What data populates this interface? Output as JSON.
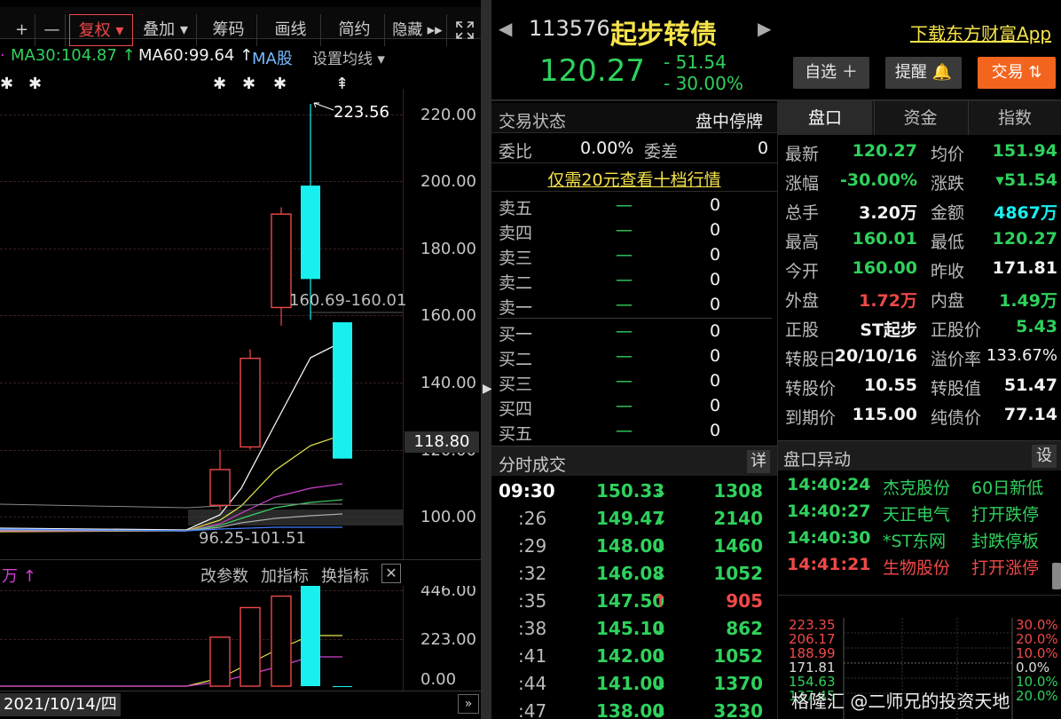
{
  "toolbar": {
    "items": [
      "+",
      "—",
      "复权 ▾",
      "叠加 ▾",
      "筹码",
      "画线",
      "简约",
      "隐藏 ▸▸"
    ],
    "expand_icon": "expand-icon"
  },
  "ma_bar": {
    "ma30": "MA30:104.87 ↑",
    "ma60": "MA60:99.64 ↑",
    "ma_type": "MA股",
    "set_ma": "设置均线 ▾"
  },
  "chart_data": {
    "type": "candlestick",
    "y_axis_ticks": [
      "220.00",
      "200.00",
      "180.00",
      "160.00",
      "140.00",
      "120.00",
      "100.00"
    ],
    "ylim": [
      91,
      228
    ],
    "annotations": {
      "high_label": "223.56",
      "range_label": "160.69-160.01",
      "low_label": "96.25-101.51",
      "current_price_tag": "118.80"
    },
    "candles": [
      {
        "open": 106.7,
        "close": 117.1,
        "high": 122.9,
        "low": 105.3,
        "color": "red"
      },
      {
        "open": 123.7,
        "close": 149.5,
        "high": 152.1,
        "low": 122.9,
        "color": "red"
      },
      {
        "open": 164.3,
        "close": 191.5,
        "high": 193.5,
        "low": 159.0,
        "color": "red"
      },
      {
        "open": 199.8,
        "close": 172.6,
        "high": 223.56,
        "low": 160.69,
        "color": "cyan"
      },
      {
        "open": 160.0,
        "close": 120.3,
        "high": 160.0,
        "low": 120.27,
        "color": "cyan"
      }
    ],
    "volume_ticks": [
      "446.00",
      "223.00",
      "0.00"
    ],
    "volume_ylim": [
      0,
      460
    ],
    "volumes": [
      {
        "value": 235,
        "color": "red"
      },
      {
        "value": 377,
        "color": "red"
      },
      {
        "value": 432,
        "color": "red"
      },
      {
        "value": 489,
        "color": "cyan"
      },
      {
        "value": 0,
        "color": "cyan"
      }
    ],
    "date_label": "2021/10/14/四"
  },
  "indicator_bar": {
    "left_text": "万 ↑",
    "change_params": "改参数",
    "add_indicator": "加指标",
    "switch_indicator": "换指标"
  },
  "header": {
    "code": "113576",
    "name": "起步转债",
    "download": "下载东方财富App",
    "price": "120.27",
    "change": "- 51.54",
    "change_pct": "- 30.00%",
    "watch_btn": "自选 ＋",
    "remind_btn": "提醒 🔔",
    "trade_btn": "交易 ⇅"
  },
  "status": {
    "label": "交易状态",
    "value": "盘中停牌",
    "weibi_label": "委比",
    "weibi_value": "0.00%",
    "weicha_label": "委差",
    "weicha_value": "0",
    "promo": "仅需20元查看十档行情"
  },
  "orderbook": {
    "sells": [
      {
        "label": "卖五",
        "price": "—",
        "vol": "0"
      },
      {
        "label": "卖四",
        "price": "—",
        "vol": "0"
      },
      {
        "label": "卖三",
        "price": "—",
        "vol": "0"
      },
      {
        "label": "卖二",
        "price": "—",
        "vol": "0"
      },
      {
        "label": "卖一",
        "price": "—",
        "vol": "0"
      }
    ],
    "buys": [
      {
        "label": "买一",
        "price": "—",
        "vol": "0"
      },
      {
        "label": "买二",
        "price": "—",
        "vol": "0"
      },
      {
        "label": "买三",
        "price": "—",
        "vol": "0"
      },
      {
        "label": "买四",
        "price": "—",
        "vol": "0"
      },
      {
        "label": "买五",
        "price": "—",
        "vol": "0"
      }
    ]
  },
  "ticks": {
    "title": "分时成交",
    "detail": "详",
    "rows": [
      {
        "time": "09:30",
        "price": "150.33",
        "dir": "down",
        "vol": "1308",
        "vcolor": "green"
      },
      {
        "time": ":26",
        "price": "149.47",
        "dir": "down",
        "vol": "2140",
        "vcolor": "green"
      },
      {
        "time": ":29",
        "price": "148.00",
        "dir": "down",
        "vol": "1460",
        "vcolor": "green"
      },
      {
        "time": ":32",
        "price": "146.08",
        "dir": "down",
        "vol": "1052",
        "vcolor": "green"
      },
      {
        "time": ":35",
        "price": "147.50",
        "dir": "up",
        "vol": "905",
        "vcolor": "red"
      },
      {
        "time": ":38",
        "price": "145.10",
        "dir": "down",
        "vol": "862",
        "vcolor": "green"
      },
      {
        "time": ":41",
        "price": "142.00",
        "dir": "down",
        "vol": "1052",
        "vcolor": "green"
      },
      {
        "time": ":44",
        "price": "141.00",
        "dir": "down",
        "vol": "1370",
        "vcolor": "green"
      },
      {
        "time": ":47",
        "price": "138.00",
        "dir": "down",
        "vol": "3230",
        "vcolor": "green"
      }
    ]
  },
  "tabs": [
    "盘口",
    "资金",
    "指数"
  ],
  "quote": [
    {
      "l1": "最新",
      "v1": "120.27",
      "c1": "green",
      "l2": "均价",
      "v2": "151.94",
      "c2": "green"
    },
    {
      "l1": "涨幅",
      "v1": "-30.00%",
      "c1": "green",
      "l2": "涨跌",
      "v2": "▾51.54",
      "c2": "green"
    },
    {
      "l1": "总手",
      "v1": "3.20万",
      "c1": "white",
      "l2": "金额",
      "v2": "4867万",
      "c2": "cyan"
    },
    {
      "l1": "最高",
      "v1": "160.01",
      "c1": "green",
      "l2": "最低",
      "v2": "120.27",
      "c2": "green"
    },
    {
      "l1": "今开",
      "v1": "160.00",
      "c1": "green",
      "l2": "昨收",
      "v2": "171.81",
      "c2": "white"
    },
    {
      "l1": "外盘",
      "v1": "1.72万",
      "c1": "red",
      "l2": "内盘",
      "v2": "1.49万",
      "c2": "green"
    },
    {
      "l1": "正股",
      "v1": "ST起步",
      "c1": "white",
      "l2": "正股价",
      "v2": "5.43",
      "c2": "green"
    },
    {
      "l1": "转股日",
      "v1": "20/10/16",
      "c1": "white",
      "l2": "溢价率",
      "v2": "133.67%",
      "c2": "white"
    },
    {
      "l1": "转股价",
      "v1": "10.55",
      "c1": "white",
      "l2": "转股值",
      "v2": "51.47",
      "c2": "white"
    },
    {
      "l1": "到期价",
      "v1": "115.00",
      "c1": "white",
      "l2": "纯债价",
      "v2": "77.14",
      "c2": "white"
    }
  ],
  "alerts": {
    "title": "盘口异动",
    "settings": "设",
    "rows": [
      {
        "time": "14:40:24",
        "name": "杰克股份",
        "event": "60日新低",
        "color": "green"
      },
      {
        "time": "14:40:27",
        "name": "天正电气",
        "event": "打开跌停",
        "color": "green"
      },
      {
        "time": "14:40:30",
        "name": "*ST东网",
        "event": "封跌停板",
        "color": "green"
      },
      {
        "time": "14:41:21",
        "name": "生物股份",
        "event": "打开涨停",
        "color": "red"
      }
    ]
  },
  "mini_chart": {
    "left_ticks": [
      "223.35",
      "206.17",
      "188.99",
      "171.81",
      "154.63",
      "137.45"
    ],
    "right_ticks": [
      "30.0%",
      "20.0%",
      "10.0%",
      "0.0%",
      "10.0%",
      "20.0%"
    ]
  },
  "watermark": "格隆汇 @二师兄的投资天地"
}
